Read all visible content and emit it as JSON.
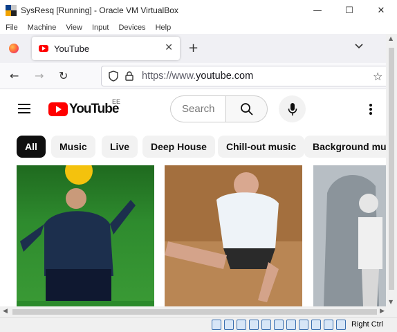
{
  "window": {
    "title": "SysResq [Running] - Oracle VM VirtualBox",
    "minimize": "—",
    "maximize": "☐",
    "close": "✕",
    "menu": [
      "File",
      "Machine",
      "View",
      "Input",
      "Devices",
      "Help"
    ]
  },
  "browser": {
    "tab_title": "YouTube",
    "tab_close": "✕",
    "new_tab": "+",
    "tab_list": "⌄",
    "back": "←",
    "forward": "→",
    "reload": "↻",
    "url_prefix": "https://www.",
    "url_domain": "youtube.com",
    "bookmark": "☆"
  },
  "youtube": {
    "logo_text": "YouTube",
    "country_code": "EE",
    "search_placeholder": "Search",
    "chips": [
      "All",
      "Music",
      "Live",
      "Deep House",
      "Chill-out music",
      "Background music"
    ],
    "active_chip": "All"
  },
  "statusbar": {
    "host_key": "Right Ctrl"
  },
  "colors": {
    "youtube_red": "#ff0000",
    "chip_active_bg": "#0f0f0f",
    "chip_bg": "#f2f2f2"
  }
}
